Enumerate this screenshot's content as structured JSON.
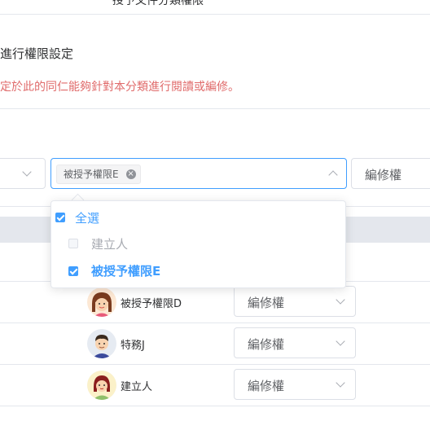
{
  "header": {
    "title_fragment": "授予文件分類權限"
  },
  "section": {
    "title": "進行權限設定",
    "hint": "定於此的同仁能夠針對本分類進行閱讀或編修。"
  },
  "form": {
    "user_select": {
      "selected_tag": "被授予權限E"
    },
    "permission_select": {
      "value": "編修權"
    }
  },
  "dropdown": {
    "options": [
      {
        "label": "全選",
        "checked": true,
        "disabled": false
      },
      {
        "label": "建立人",
        "checked": false,
        "disabled": true
      },
      {
        "label": "被授予權限E",
        "checked": true,
        "disabled": false
      }
    ]
  },
  "table": {
    "rows": [
      {
        "name": "被授予權限D",
        "permission": "編修權",
        "avatar": "female-avatar"
      },
      {
        "name": "特務J",
        "permission": "編修權",
        "avatar": "male-avatar"
      },
      {
        "name": "建立人",
        "permission": "編修權",
        "avatar": "female-avatar-2"
      }
    ]
  },
  "colors": {
    "accent": "#409eff",
    "hint": "#e06b6b",
    "border": "#dcdfe6"
  }
}
